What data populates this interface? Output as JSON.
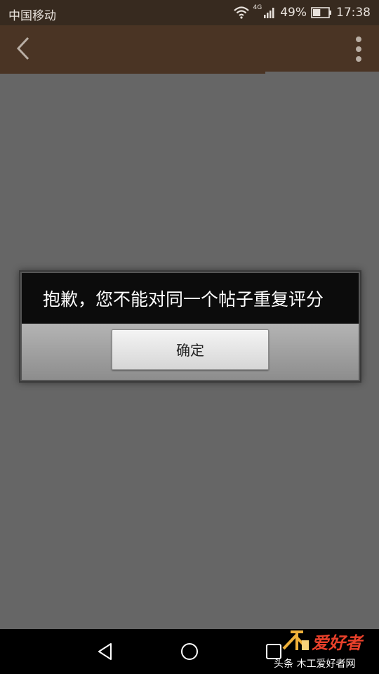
{
  "status_bar": {
    "carrier": "中国移动",
    "network_type": "4G",
    "battery_percent": "49%",
    "battery_level": 0.49,
    "time": "17:38",
    "icons": [
      "wifi-icon",
      "signal-icon",
      "battery-icon"
    ]
  },
  "toolbar": {
    "background_color": "#4a3424",
    "back_icon": "back-arrow-icon",
    "menu_icon": "more-vertical-icon"
  },
  "dialog": {
    "message": "抱歉，您不能对同一个帖子重复评分",
    "confirm_label": "确定"
  },
  "nav_bar": {
    "icons": [
      "nav-back-icon",
      "nav-home-icon",
      "nav-recents-icon"
    ]
  },
  "watermark": {
    "logo_text": "爱好者",
    "caption": "头条  木工爱好者网",
    "accent_color": "#e8402a"
  }
}
